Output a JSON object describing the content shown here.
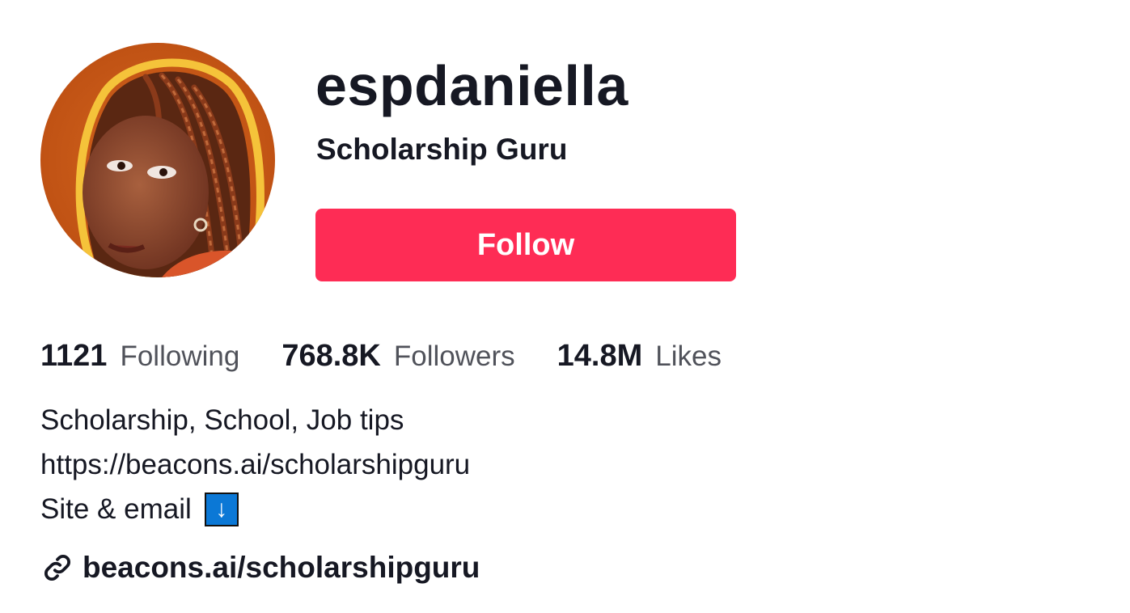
{
  "profile": {
    "username": "espdaniella",
    "nickname": "Scholarship Guru",
    "follow_label": "Follow",
    "avatar_alt": "espdaniella"
  },
  "stats": [
    {
      "value": "1121",
      "label": "Following"
    },
    {
      "value": "768.8K",
      "label": "Followers"
    },
    {
      "value": "14.8M",
      "label": "Likes"
    }
  ],
  "bio": {
    "line1": "Scholarship, School, Job tips",
    "line2": "https://beacons.ai/scholarshipguru",
    "line3": "Site & email",
    "line3_emoji": "↓"
  },
  "link": {
    "text": "beacons.ai/scholarshipguru",
    "icon": "link-icon"
  },
  "colors": {
    "accent": "#fe2c55",
    "text": "#161823",
    "emoji_box": "#0b78d6"
  }
}
